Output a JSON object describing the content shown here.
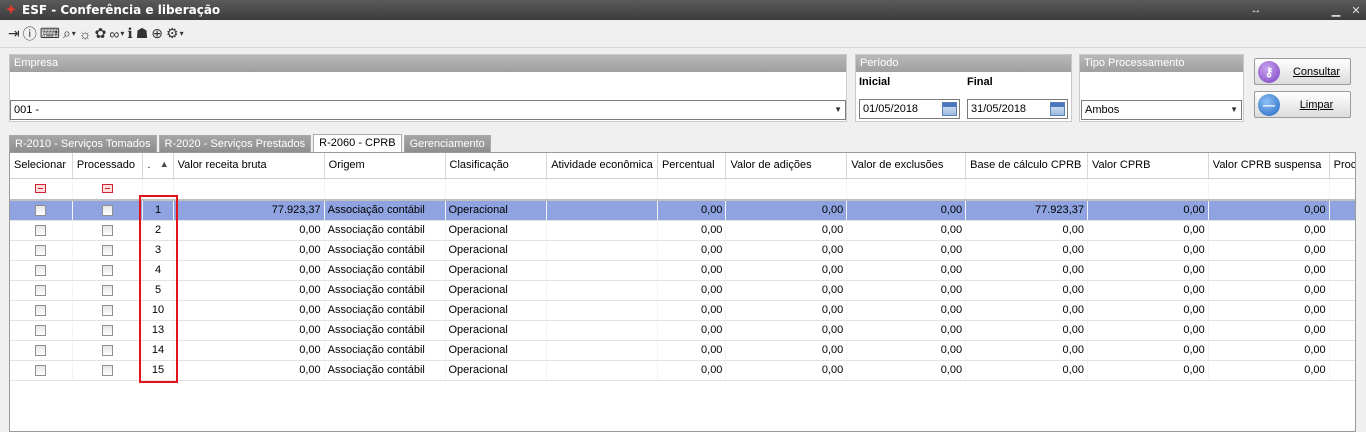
{
  "window": {
    "title": "ESF - Conferência e liberação"
  },
  "toolbar": {
    "icons": [
      "exit-icon",
      "help-icon",
      "keyboard-icon",
      "search-icon",
      "lightbulb-icon",
      "puzzle-icon",
      "link-icon",
      "info-icon",
      "user-icon",
      "add-page-icon",
      "settings-icon"
    ]
  },
  "filters": {
    "empresa": {
      "label": "Empresa",
      "value": "001 -"
    },
    "periodo": {
      "label": "Período",
      "inicial_label": "Inicial",
      "final_label": "Final",
      "inicial": "01/05/2018",
      "final": "31/05/2018"
    },
    "tipo": {
      "label": "Tipo Processamento",
      "value": "Ambos"
    }
  },
  "buttons": {
    "consultar": "Consultar",
    "limpar": "Limpar"
  },
  "tabs": [
    {
      "label": "R-2010 - Serviços Tomados",
      "active": false
    },
    {
      "label": "R-2020 - Serviços Prestados",
      "active": false
    },
    {
      "label": "R-2060 - CPRB",
      "active": true
    },
    {
      "label": "Gerenciamento",
      "active": false
    }
  ],
  "grid": {
    "columns": [
      "Selecionar",
      "Processado",
      ".",
      "Valor receita bruta",
      "Origem",
      "Clasificação",
      "Atividade econômica",
      "Percentual",
      "Valor de adições",
      "Valor de exclusões",
      "Base de cálculo CPRB",
      "Valor CPRB",
      "Valor CPRB suspensa",
      "Proces"
    ],
    "rows": [
      {
        "id": "1",
        "receita": "77.923,37",
        "origem": "Associação contábil",
        "clasificacao": "Operacional",
        "atividade": "",
        "percentual": "0,00",
        "adicoes": "0,00",
        "exclusoes": "0,00",
        "base": "77.923,37",
        "cprb": "0,00",
        "suspensa": "0,00"
      },
      {
        "id": "2",
        "receita": "0,00",
        "origem": "Associação contábil",
        "clasificacao": "Operacional",
        "atividade": "",
        "percentual": "0,00",
        "adicoes": "0,00",
        "exclusoes": "0,00",
        "base": "0,00",
        "cprb": "0,00",
        "suspensa": "0,00"
      },
      {
        "id": "3",
        "receita": "0,00",
        "origem": "Associação contábil",
        "clasificacao": "Operacional",
        "atividade": "",
        "percentual": "0,00",
        "adicoes": "0,00",
        "exclusoes": "0,00",
        "base": "0,00",
        "cprb": "0,00",
        "suspensa": "0,00"
      },
      {
        "id": "4",
        "receita": "0,00",
        "origem": "Associação contábil",
        "clasificacao": "Operacional",
        "atividade": "",
        "percentual": "0,00",
        "adicoes": "0,00",
        "exclusoes": "0,00",
        "base": "0,00",
        "cprb": "0,00",
        "suspensa": "0,00"
      },
      {
        "id": "5",
        "receita": "0,00",
        "origem": "Associação contábil",
        "clasificacao": "Operacional",
        "atividade": "",
        "percentual": "0,00",
        "adicoes": "0,00",
        "exclusoes": "0,00",
        "base": "0,00",
        "cprb": "0,00",
        "suspensa": "0,00"
      },
      {
        "id": "10",
        "receita": "0,00",
        "origem": "Associação contábil",
        "clasificacao": "Operacional",
        "atividade": "",
        "percentual": "0,00",
        "adicoes": "0,00",
        "exclusoes": "0,00",
        "base": "0,00",
        "cprb": "0,00",
        "suspensa": "0,00"
      },
      {
        "id": "13",
        "receita": "0,00",
        "origem": "Associação contábil",
        "clasificacao": "Operacional",
        "atividade": "",
        "percentual": "0,00",
        "adicoes": "0,00",
        "exclusoes": "0,00",
        "base": "0,00",
        "cprb": "0,00",
        "suspensa": "0,00"
      },
      {
        "id": "14",
        "receita": "0,00",
        "origem": "Associação contábil",
        "clasificacao": "Operacional",
        "atividade": "",
        "percentual": "0,00",
        "adicoes": "0,00",
        "exclusoes": "0,00",
        "base": "0,00",
        "cprb": "0,00",
        "suspensa": "0,00"
      },
      {
        "id": "15",
        "receita": "0,00",
        "origem": "Associação contábil",
        "clasificacao": "Operacional",
        "atividade": "",
        "percentual": "0,00",
        "adicoes": "0,00",
        "exclusoes": "0,00",
        "base": "0,00",
        "cprb": "0,00",
        "suspensa": "0,00"
      }
    ]
  },
  "colors": {
    "selected_row": "#8ea3e0",
    "highlight_box": "#e2141b",
    "panel_header": "#a8a8a8"
  }
}
